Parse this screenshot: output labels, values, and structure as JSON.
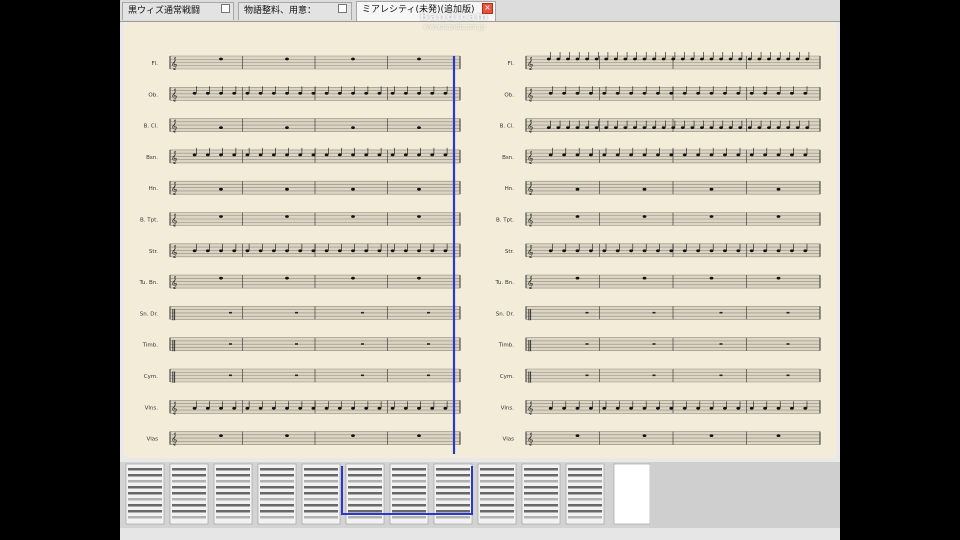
{
  "tabs": [
    {
      "label": "黒ウィズ通常戦闘",
      "active": false
    },
    {
      "label": "物語整料、用意：",
      "active": false
    },
    {
      "label": "ミアレシティ(未発)(追加版)",
      "active": true
    }
  ],
  "instruments": [
    "Fl.",
    "Ob.",
    "B. Cl.",
    "Bsn.",
    "Hn.",
    "B. Tpt.",
    "Str.",
    "Tu. Bn.",
    "Sn. Dr.",
    "Timb.",
    "Cym.",
    "Vlns.",
    "Vlas"
  ],
  "watermark": {
    "title": "Bandicam",
    "subtitle": "www.bandicam.jp"
  },
  "colors": {
    "paper": "#f3ecd9",
    "staff": "#b9b4a6",
    "playhead": "#2b39c8",
    "highlight": "#2b39c8"
  }
}
